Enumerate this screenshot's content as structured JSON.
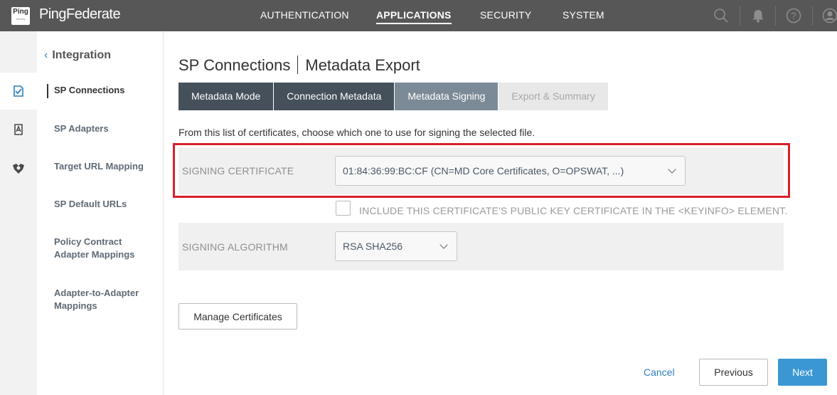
{
  "brand": {
    "logo_text": "Ping",
    "logo_subtext": "Identity",
    "product": "PingFederate"
  },
  "nav": {
    "items": [
      {
        "label": "AUTHENTICATION"
      },
      {
        "label": "APPLICATIONS",
        "active": true
      },
      {
        "label": "SECURITY"
      },
      {
        "label": "SYSTEM"
      }
    ],
    "icons": [
      "search-icon",
      "bell-icon",
      "help-icon",
      "user-icon"
    ]
  },
  "rail": {
    "icons": [
      "applications-icon",
      "adapters-icon",
      "connections-icon"
    ]
  },
  "sidebar": {
    "back_label": "Integration",
    "items": [
      {
        "label": "SP Connections",
        "active": true
      },
      {
        "label": "SP Adapters"
      },
      {
        "label": "Target URL Mapping"
      },
      {
        "label": "SP Default URLs"
      },
      {
        "label": "Policy Contract\nAdapter Mappings"
      },
      {
        "label": "Adapter-to-Adapter\nMappings"
      }
    ]
  },
  "page": {
    "title_left": "SP Connections",
    "title_right": "Metadata Export"
  },
  "tabs": [
    {
      "label": "Metadata Mode",
      "state": "done"
    },
    {
      "label": "Connection Metadata",
      "state": "done"
    },
    {
      "label": "Metadata Signing",
      "state": "current"
    },
    {
      "label": "Export & Summary",
      "state": "disabled"
    }
  ],
  "description": "From this list of certificates, choose which one to use for signing the selected file.",
  "signing_certificate": {
    "label": "SIGNING CERTIFICATE",
    "value": "01:84:36:99:BC:CF (CN=MD Core Certificates, O=OPSWAT, ...)"
  },
  "include_keyinfo": {
    "label": "INCLUDE THIS CERTIFICATE'S PUBLIC KEY CERTIFICATE IN THE <KEYINFO> ELEMENT.",
    "checked": false
  },
  "signing_algorithm": {
    "label": "SIGNING ALGORITHM",
    "value": "RSA SHA256"
  },
  "buttons": {
    "manage_certificates": "Manage Certificates",
    "cancel": "Cancel",
    "previous": "Previous",
    "next": "Next"
  },
  "colors": {
    "accent": "#3a97d4",
    "highlight": "#d8202a",
    "topbar": "#575757"
  }
}
